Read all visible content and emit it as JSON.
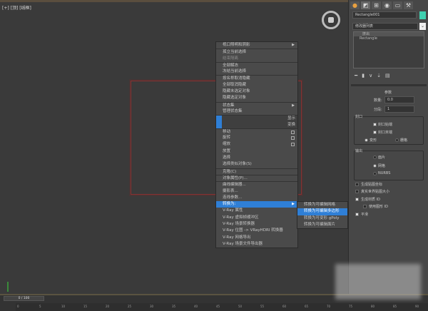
{
  "viewport": {
    "label": "[+] [顶] [线框]"
  },
  "menu": [
    {
      "label": "视口照明和阴影",
      "arrow": true
    },
    {
      "label": "孤立当前选择",
      "sep": true
    },
    {
      "label": "结束隔离",
      "dis": true
    },
    {
      "label": "全部解冻",
      "sep": true
    },
    {
      "label": "冻结当前选择"
    },
    {
      "label": "按名称取消隐藏",
      "sep": true
    },
    {
      "label": "全部取消隐藏"
    },
    {
      "label": "隐藏未选定对象"
    },
    {
      "label": "隐藏选定对象"
    },
    {
      "label": "状态集",
      "arrow": true,
      "sep": true
    },
    {
      "label": "管理状态集"
    },
    {
      "label": "",
      "right": "显示",
      "blue": true,
      "sep": true
    },
    {
      "label": "",
      "right": "变换",
      "blue": true
    },
    {
      "label": "移动",
      "box": true,
      "sep": true
    },
    {
      "label": "旋转",
      "box": true
    },
    {
      "label": "缩放",
      "box": true
    },
    {
      "label": "放置"
    },
    {
      "label": "选择"
    },
    {
      "label": "选择类似对象(S)"
    },
    {
      "label": "克隆(C)",
      "sep": true
    },
    {
      "label": "对象属性(P)...",
      "sep": true
    },
    {
      "label": "曲线编辑器...",
      "sep": true
    },
    {
      "label": "摄影表..."
    },
    {
      "label": "连线参数..."
    },
    {
      "label": "转换为:",
      "arrow": true,
      "hl": true
    },
    {
      "label": "V-Ray 属性"
    },
    {
      "label": "V-Ray 虚拟帧缓冲区"
    },
    {
      "label": "V-Ray 场景转换器"
    },
    {
      "label": "V-Ray 位图 -> VRayHDRI 转换器"
    },
    {
      "label": "V-Ray 网格导出"
    },
    {
      "label": "V-Ray 场景文件导出器"
    }
  ],
  "submenu": [
    {
      "label": "转换为可编辑网格"
    },
    {
      "label": "转换为可编辑多边形",
      "hl": true
    },
    {
      "label": "转换为可变形 gPoly"
    },
    {
      "label": "转换为可编辑面片"
    }
  ],
  "panel": {
    "object_name": "Rectangle001",
    "object_color": "#3fd0b0",
    "modifier_list": "修改器列表",
    "stack": [
      "挤出",
      "Rectangle"
    ],
    "rollout": "参数",
    "amount_label": "数量:",
    "amount": "0.0",
    "segments_label": "分段:",
    "segments": "1",
    "capping": "封口",
    "cap_start": "封口始端",
    "cap_end": "封口末端",
    "morph": "变形",
    "grid": "栅格",
    "output": "输出",
    "patch": "面片",
    "mesh": "网格",
    "nurbs": "NURBS",
    "gen_map": "生成贴图坐标",
    "real_world": "真实世界贴图大小",
    "gen_mat": "生成材质 ID",
    "use_shape": "使用图形 ID",
    "smooth": "平滑"
  },
  "timeline": {
    "frame": "0 / 100",
    "ticks": [
      "0",
      "5",
      "10",
      "15",
      "20",
      "25",
      "30",
      "35",
      "40",
      "45",
      "50",
      "55",
      "60",
      "65",
      "70",
      "75",
      "80",
      "85",
      "90"
    ]
  }
}
